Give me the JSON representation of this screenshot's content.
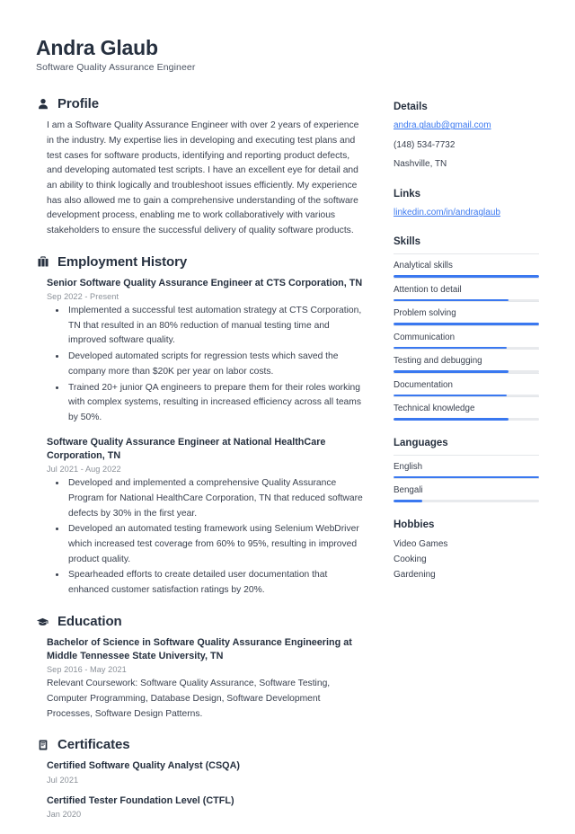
{
  "header": {
    "name": "Andra Glaub",
    "job_title": "Software Quality Assurance Engineer"
  },
  "accent_color": "#3a78f0",
  "sections": {
    "profile": {
      "title": "Profile",
      "icon": "user-icon",
      "text": "I am a Software Quality Assurance Engineer with over 2 years of experience in the industry. My expertise lies in developing and executing test plans and test cases for software products, identifying and reporting product defects, and developing automated test scripts. I have an excellent eye for detail and an ability to think logically and troubleshoot issues efficiently. My experience has also allowed me to gain a comprehensive understanding of the software development process, enabling me to work collaboratively with various stakeholders to ensure the successful delivery of quality software products."
    },
    "employment": {
      "title": "Employment History",
      "icon": "briefcase-icon",
      "entries": [
        {
          "title": "Senior Software Quality Assurance Engineer at CTS Corporation, TN",
          "date": "Sep 2022 - Present",
          "bullets": [
            "Implemented a successful test automation strategy at CTS Corporation, TN that resulted in an 80% reduction of manual testing time and improved software quality.",
            "Developed automated scripts for regression tests which saved the company more than $20K per year on labor costs.",
            "Trained 20+ junior QA engineers to prepare them for their roles working with complex systems, resulting in increased efficiency across all teams by 50%."
          ]
        },
        {
          "title": "Software Quality Assurance Engineer at National HealthCare Corporation, TN",
          "date": "Jul 2021 - Aug 2022",
          "bullets": [
            "Developed and implemented a comprehensive Quality Assurance Program for National HealthCare Corporation, TN that reduced software defects by 30% in the first year.",
            "Developed an automated testing framework using Selenium WebDriver which increased test coverage from 60% to 95%, resulting in improved product quality.",
            "Spearheaded efforts to create detailed user documentation that enhanced customer satisfaction ratings by 20%."
          ]
        }
      ]
    },
    "education": {
      "title": "Education",
      "icon": "graduation-cap-icon",
      "entries": [
        {
          "title": "Bachelor of Science in Software Quality Assurance Engineering at Middle Tennessee State University, TN",
          "date": "Sep 2016 - May 2021",
          "description": "Relevant Coursework: Software Quality Assurance, Software Testing, Computer Programming, Database Design, Software Development Processes, Software Design Patterns."
        }
      ]
    },
    "certificates": {
      "title": "Certificates",
      "icon": "clipboard-icon",
      "entries": [
        {
          "title": "Certified Software Quality Analyst (CSQA)",
          "date": "Jul 2021"
        },
        {
          "title": "Certified Tester Foundation Level (CTFL)",
          "date": "Jan 2020"
        }
      ]
    }
  },
  "sidebar": {
    "details": {
      "title": "Details",
      "email": "andra.glaub@gmail.com",
      "phone": "(148) 534-7732",
      "location": "Nashville, TN"
    },
    "links": {
      "title": "Links",
      "items": [
        {
          "label": "linkedin.com/in/andraglaub"
        }
      ]
    },
    "skills": {
      "title": "Skills",
      "items": [
        {
          "label": "Analytical skills",
          "level": 100
        },
        {
          "label": "Attention to detail",
          "level": 79
        },
        {
          "label": "Problem solving",
          "level": 100
        },
        {
          "label": "Communication",
          "level": 78
        },
        {
          "label": "Testing and debugging",
          "level": 79
        },
        {
          "label": "Documentation",
          "level": 78
        },
        {
          "label": "Technical knowledge",
          "level": 79
        }
      ]
    },
    "languages": {
      "title": "Languages",
      "items": [
        {
          "label": "English",
          "level": 100
        },
        {
          "label": "Bengali",
          "level": 20
        }
      ]
    },
    "hobbies": {
      "title": "Hobbies",
      "items": [
        {
          "label": "Video Games"
        },
        {
          "label": "Cooking"
        },
        {
          "label": "Gardening"
        }
      ]
    }
  }
}
